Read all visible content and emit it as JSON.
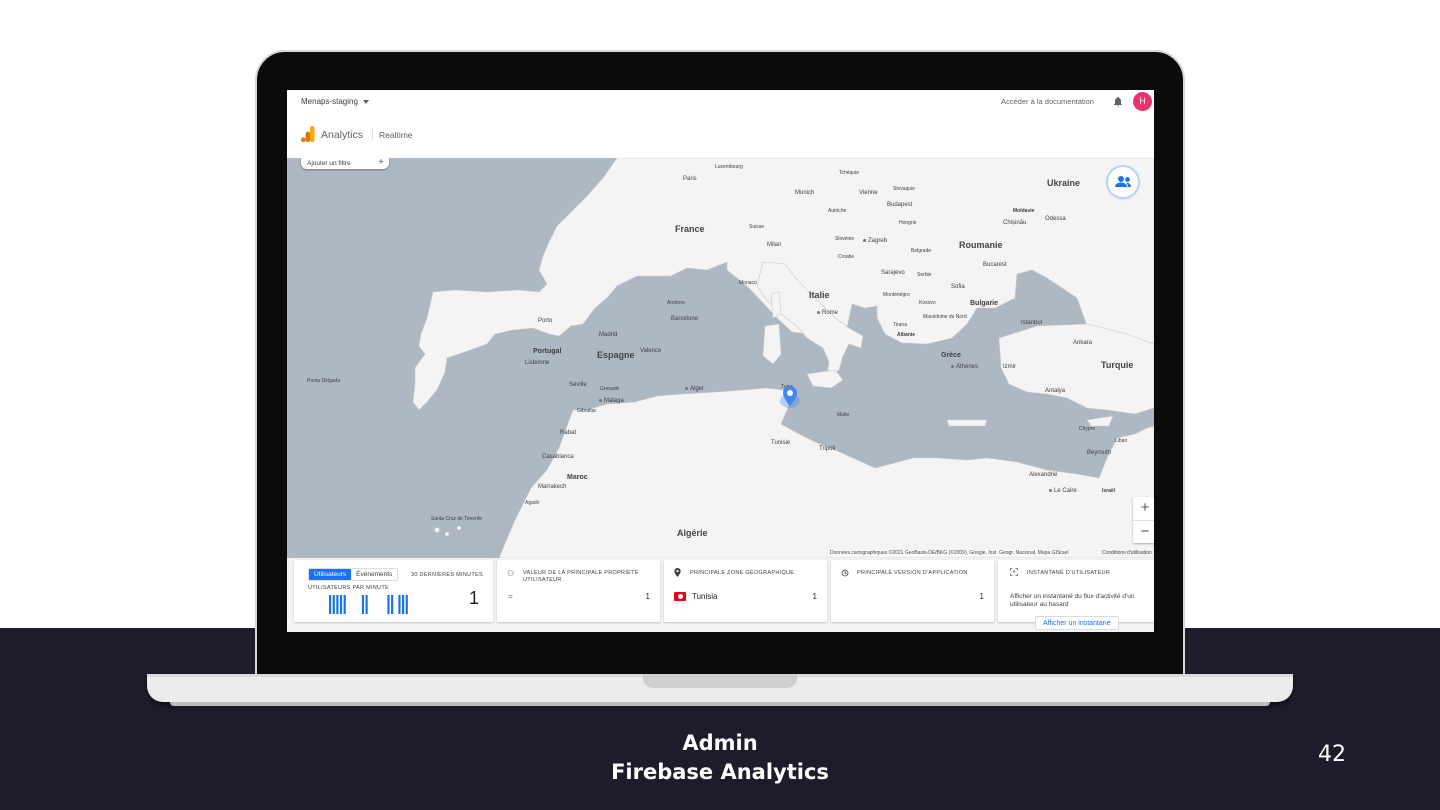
{
  "topbar": {
    "project": "Menaps-staging",
    "doc_link": "Accéder à la documentation",
    "avatar_initial": "H"
  },
  "brand": {
    "product": "Analytics",
    "page": "Realtime"
  },
  "map": {
    "filter_label": "Ajouter un filtre",
    "zoom_in": "+",
    "zoom_out": "−",
    "attribution": "Données cartographiques ©2021 GeoBasis-DE/BKG (©2009), Google, Inst. Geogr. Nacional, Mapa GISrael",
    "terms": "Conditions d'utilisation",
    "labels": {
      "france": "France",
      "espagne": "Espagne",
      "italie": "Italie",
      "algerie": "Algérie",
      "maroc": "Maroc",
      "portugal": "Portugal",
      "ukraine": "Ukraine",
      "roumanie": "Roumanie",
      "turquie": "Turquie",
      "paris": "Paris",
      "madrid": "Madrid",
      "lisbonne": "Lisbonne",
      "rome": "Rome",
      "tunis": "Tunis",
      "alger": "Alger",
      "rabat": "Rabat",
      "casablanca": "Casablanca",
      "marrakech": "Marrakech",
      "tripoli": "Tripoli",
      "istanbul": "Istanbul",
      "ankara": "Ankara",
      "athenes": "Athènes",
      "budapest": "Budapest",
      "bucarest": "Bucarest",
      "munich": "Munich",
      "vienne": "Vienne",
      "barcelone": "Barcelone",
      "valence": "Valence",
      "seville": "Séville",
      "porto": "Porto",
      "malaga": "Málaga",
      "grenade": "Grenade",
      "gibraltar": "Gibraltar",
      "milan": "Milan",
      "monaco": "Monaco",
      "andorre": "Andorre",
      "suisse": "Suisse",
      "slovenie": "Slovénie",
      "croatie": "Croatie",
      "zagreb": "Zagreb",
      "serbie": "Serbie",
      "hongrie": "Hongrie",
      "slovaquie": "Slovaquie",
      "tcheque": "Tchéquie",
      "autriche": "Autriche",
      "bulgarie": "Bulgarie",
      "sofia": "Sofia",
      "grece": "Grèce",
      "albanie": "Albanie",
      "tirana": "Tirana",
      "kosovo": "Kosovo",
      "montenegro": "Monténégro",
      "macedoine": "Macédoine du Nord",
      "belgrade": "Belgrade",
      "sarajevo": "Sarajevo",
      "moldavie": "Moldavie",
      "chisinau": "Chișinău",
      "odessa": "Odessa",
      "luxembourg": "Luxembourg",
      "malte": "Malte",
      "chypre": "Chypre",
      "liban": "Liban",
      "beyrouth": "Beyrouth",
      "alexandrie": "Alexandrie",
      "le_caire": "Le Caire",
      "israel": "Israël",
      "izmir": "Izmir",
      "antalya": "Antalya",
      "tunisie": "Tunisie",
      "ponta_delgada": "Ponta Delgada",
      "santa_cruz": "Santa Cruz de Tenerife",
      "agadir": "Agadir"
    }
  },
  "cards": {
    "users": {
      "tab_users": "Utilisateurs",
      "tab_events": "Événements",
      "period": "30 DERNIÈRES MINUTES",
      "per_minute": "UTILISATEURS PAR MINUTE",
      "value": "1",
      "bars_per_minute": [
        1,
        1,
        1,
        1,
        1,
        0,
        0,
        0,
        0,
        1,
        1,
        0,
        0,
        0,
        0,
        0,
        1,
        1,
        0,
        1,
        1,
        1
      ]
    },
    "user_property": {
      "title": "VALEUR DE LA PRINCIPALE PROPRIÉTÉ UTILISATEUR",
      "key": "=",
      "value": "1"
    },
    "geo": {
      "title": "PRINCIPALE ZONE GÉOGRAPHIQUE",
      "country": "Tunisia",
      "value": "1"
    },
    "app_version": {
      "title": "PRINCIPALE VERSION D'APPLICATION",
      "value": "1"
    },
    "snapshot": {
      "title": "INSTANTANÉ D'UTILISATEUR",
      "text": "Afficher un instantané du flux d'activité d'un utilisateur au hasard",
      "button": "Afficher un instantané"
    }
  },
  "caption": {
    "line1": "Admin",
    "line2": "Firebase Analytics"
  },
  "page_number": "42",
  "colors": {
    "accent": "#1a73e8",
    "avatar": "#e8336d",
    "slide_dark": "#1d1c2a",
    "analytics_orange": "#f9ab00"
  }
}
